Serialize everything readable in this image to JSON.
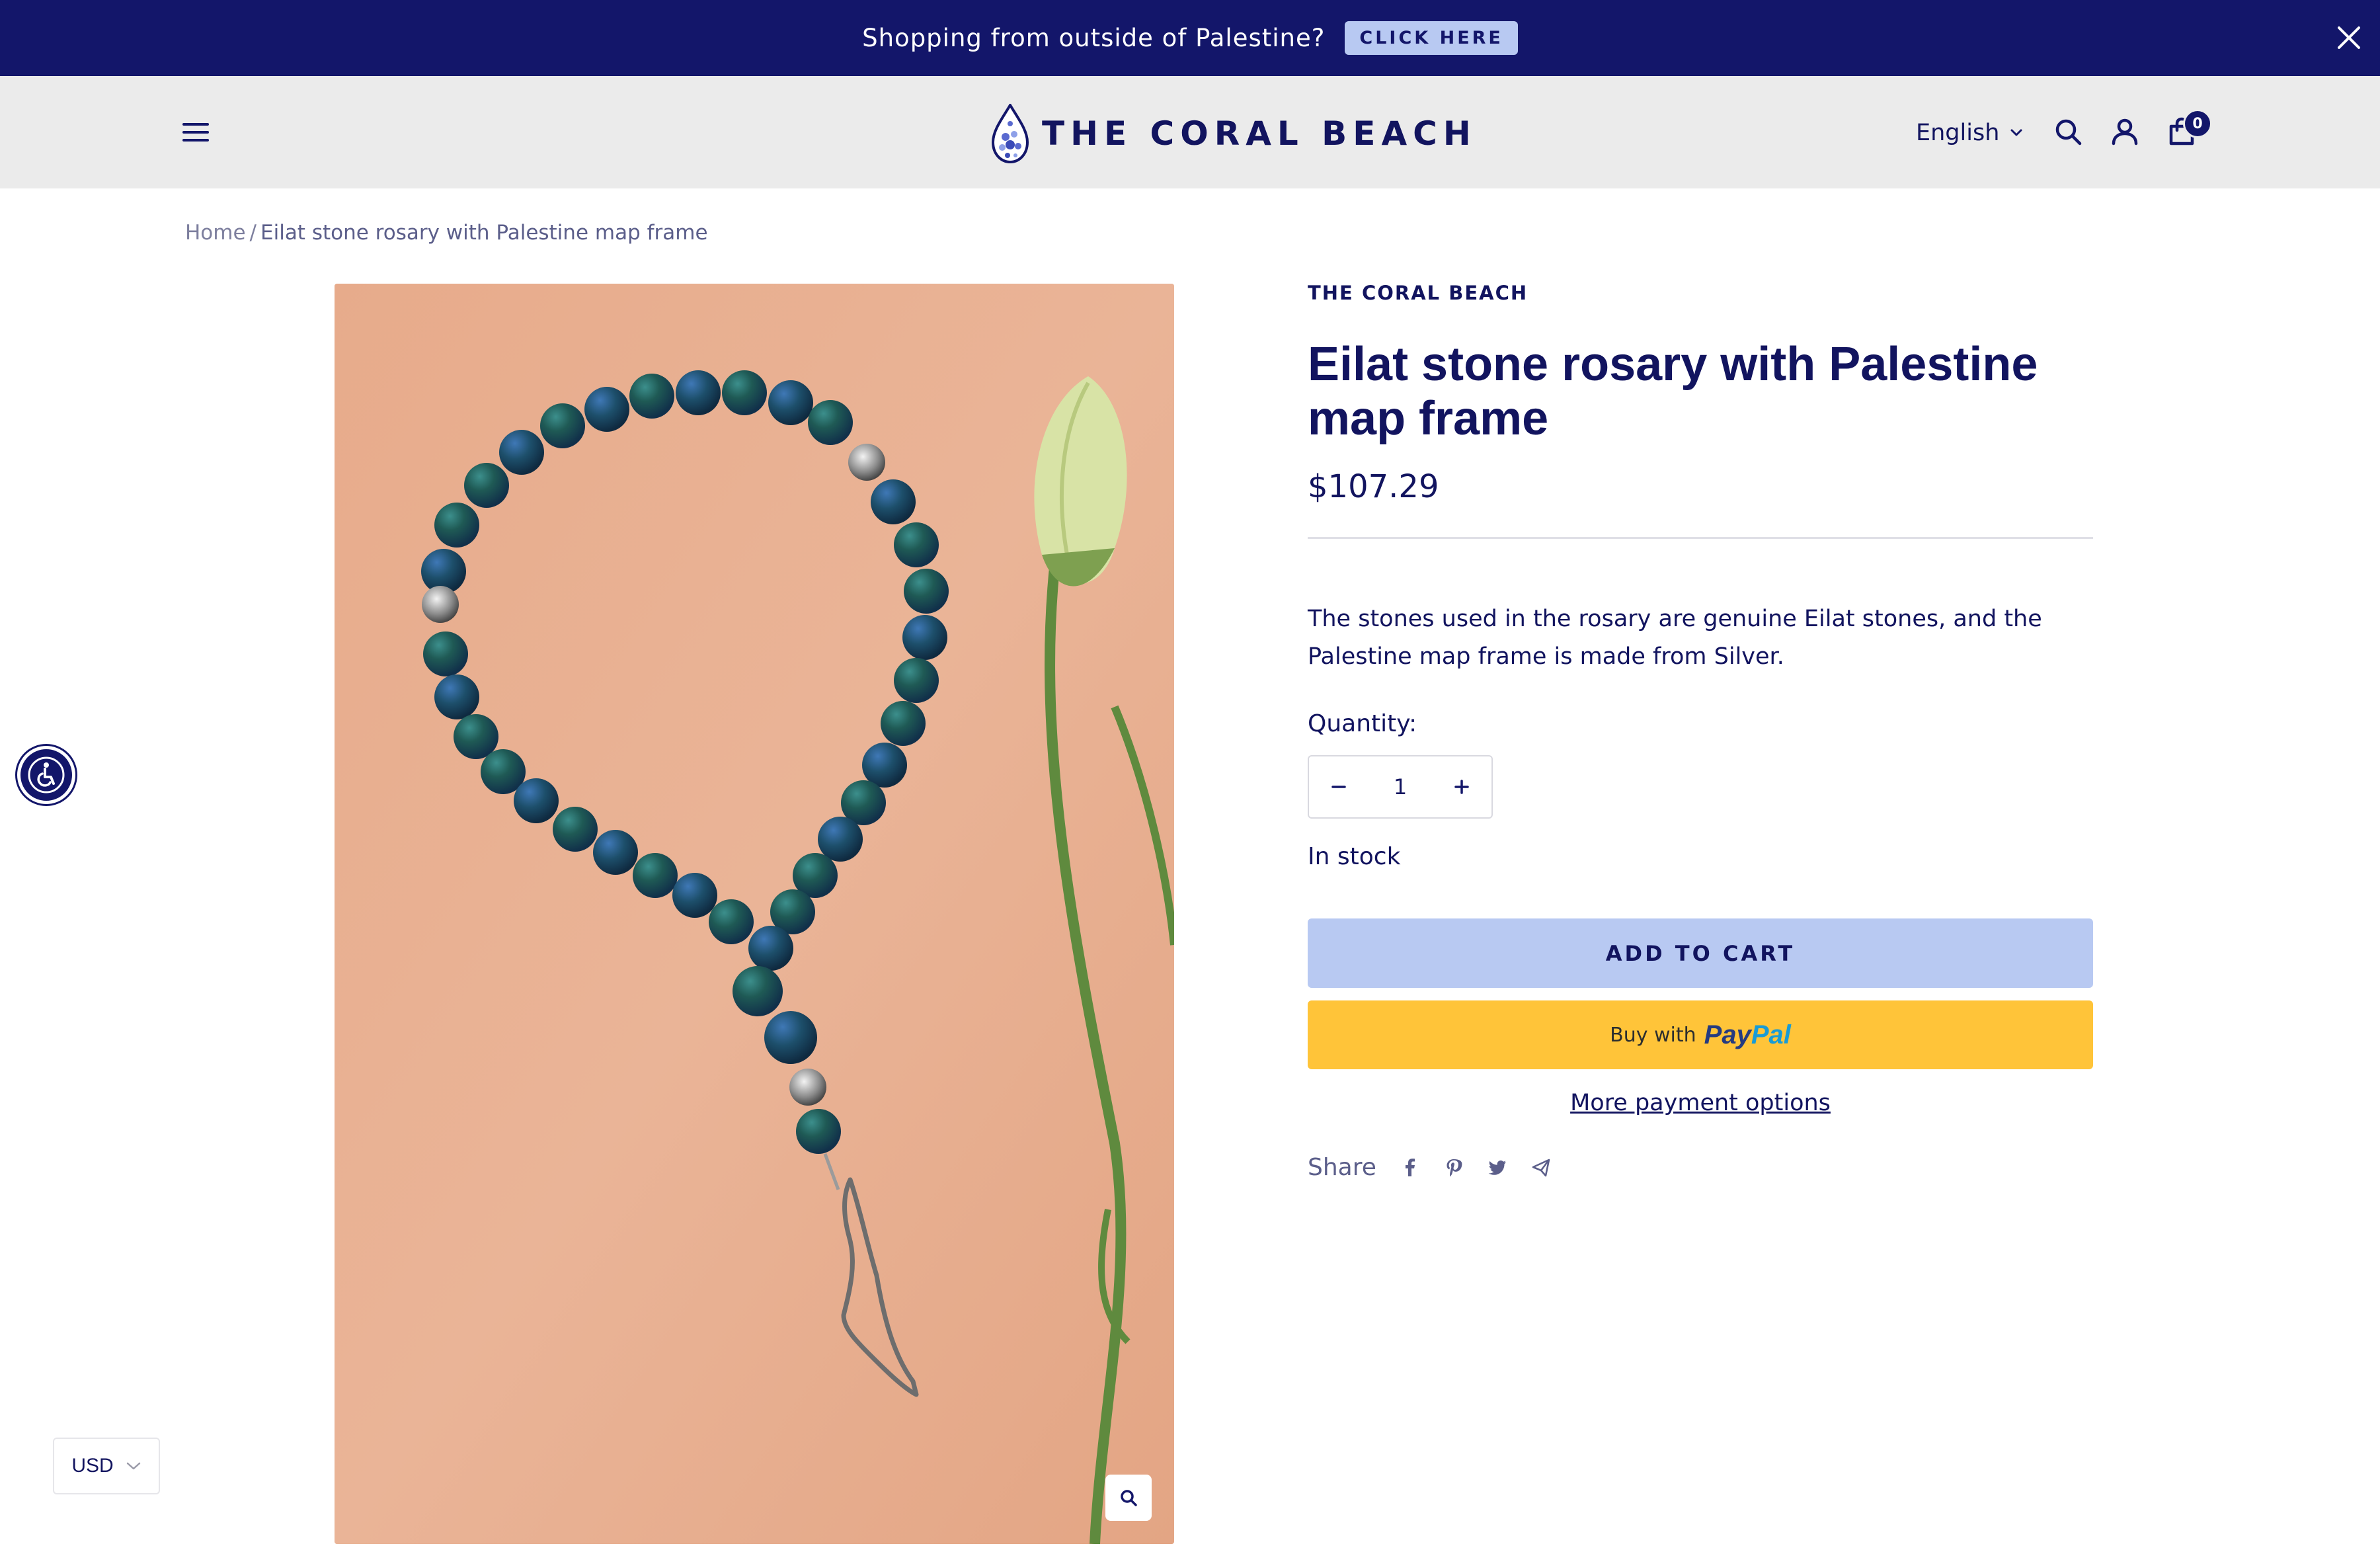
{
  "announcement": {
    "text": "Shopping from outside of Palestine?",
    "button_label": "CLICK HERE"
  },
  "header": {
    "logo_text": "THE CORAL BEACH",
    "language": "English",
    "cart_count": "0"
  },
  "breadcrumb": {
    "home": "Home",
    "separator": "/",
    "current": "Eilat stone rosary with Palestine map frame"
  },
  "product": {
    "vendor": "THE CORAL BEACH",
    "title": "Eilat stone rosary with Palestine map frame",
    "price": "$107.29",
    "description": "The stones used in the rosary are genuine Eilat stones, and the Palestine map frame is made from Silver.",
    "quantity_label": "Quantity:",
    "quantity_value": "1",
    "stock_status": "In stock",
    "add_to_cart_label": "ADD TO CART",
    "paypal_prefix": "Buy with",
    "paypal_brand_pay": "Pay",
    "paypal_brand_pal": "Pal",
    "more_payment_label": "More payment options",
    "share_label": "Share",
    "share_icons": [
      "facebook-icon",
      "pinterest-icon",
      "twitter-icon",
      "email-icon"
    ]
  },
  "currency": {
    "selected": "USD"
  },
  "colors": {
    "brand_navy": "#13166a",
    "accent_light_blue": "#b8c9f2",
    "paypal_yellow": "#ffc439",
    "header_gray": "#ebebeb",
    "image_background": "#e8ae8f"
  }
}
